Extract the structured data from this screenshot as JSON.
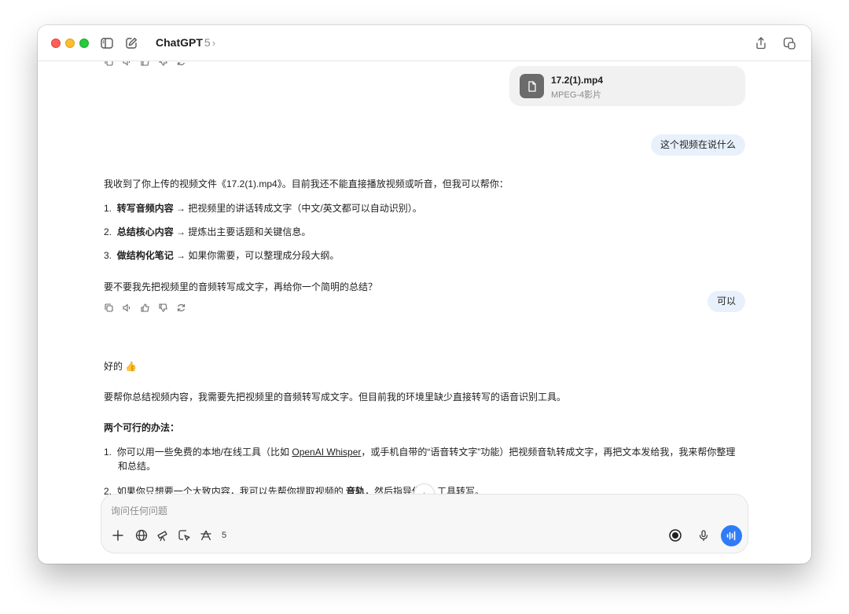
{
  "window": {
    "app_title": "ChatGPT",
    "model_version": "5",
    "chevron": "›"
  },
  "icons": {
    "sidebar": "sidebar-toggle-icon",
    "new_chat": "new-chat-icon",
    "share": "share-icon",
    "temporary_chat": "temporary-chat-icon"
  },
  "conversation": {
    "attachment": {
      "name": "17.2(1).mp4",
      "type": "MPEG-4影片"
    },
    "user_message_1": "这个视频在说什么",
    "assistant_1": {
      "intro": "我收到了你上传的视频文件《17.2(1).mp4》。目前我还不能直接播放视频或听音，但我可以帮你：",
      "items": [
        {
          "num": "1.",
          "bold": "转写音频内容",
          "rest": " → 把视频里的讲话转成文字（中文/英文都可以自动识别）。"
        },
        {
          "num": "2.",
          "bold": "总结核心内容",
          "rest": " → 提炼出主要话题和关键信息。"
        },
        {
          "num": "3.",
          "bold": "做结构化笔记",
          "rest": " → 如果你需要，可以整理成分段大纲。"
        }
      ],
      "question": "要不要我先把视频里的音频转写成文字，再给你一个简明的总结？"
    },
    "user_message_2": "可以",
    "assistant_2": {
      "greeting": "好的 👍",
      "para": "要帮你总结视频内容，我需要先把视频里的音频转写成文字。但目前我的环境里缺少直接转写的语音识别工具。",
      "heading": "两个可行的办法：",
      "item1_num": "1.",
      "item1_pre": "你可以用一些免费的本地/在线工具（比如 ",
      "item1_link": "OpenAI Whisper",
      "item1_post": "，或手机自带的“语音转文字”功能）把视频音轨转成文字，再把文本发给我，我来帮你整理",
      "item1_cont": "和总结。",
      "item2_num": "2.",
      "item2_pre": "如果你只想要一个大致内容，我可以先帮你提取视频的 ",
      "item2_bold": "音轨",
      "item2_mid": "，然后指导你",
      "item2_tail": "工具转写。"
    },
    "scroll_down_icon": "↓"
  },
  "composer": {
    "placeholder": "询问任何问题",
    "tools_count": "5"
  }
}
